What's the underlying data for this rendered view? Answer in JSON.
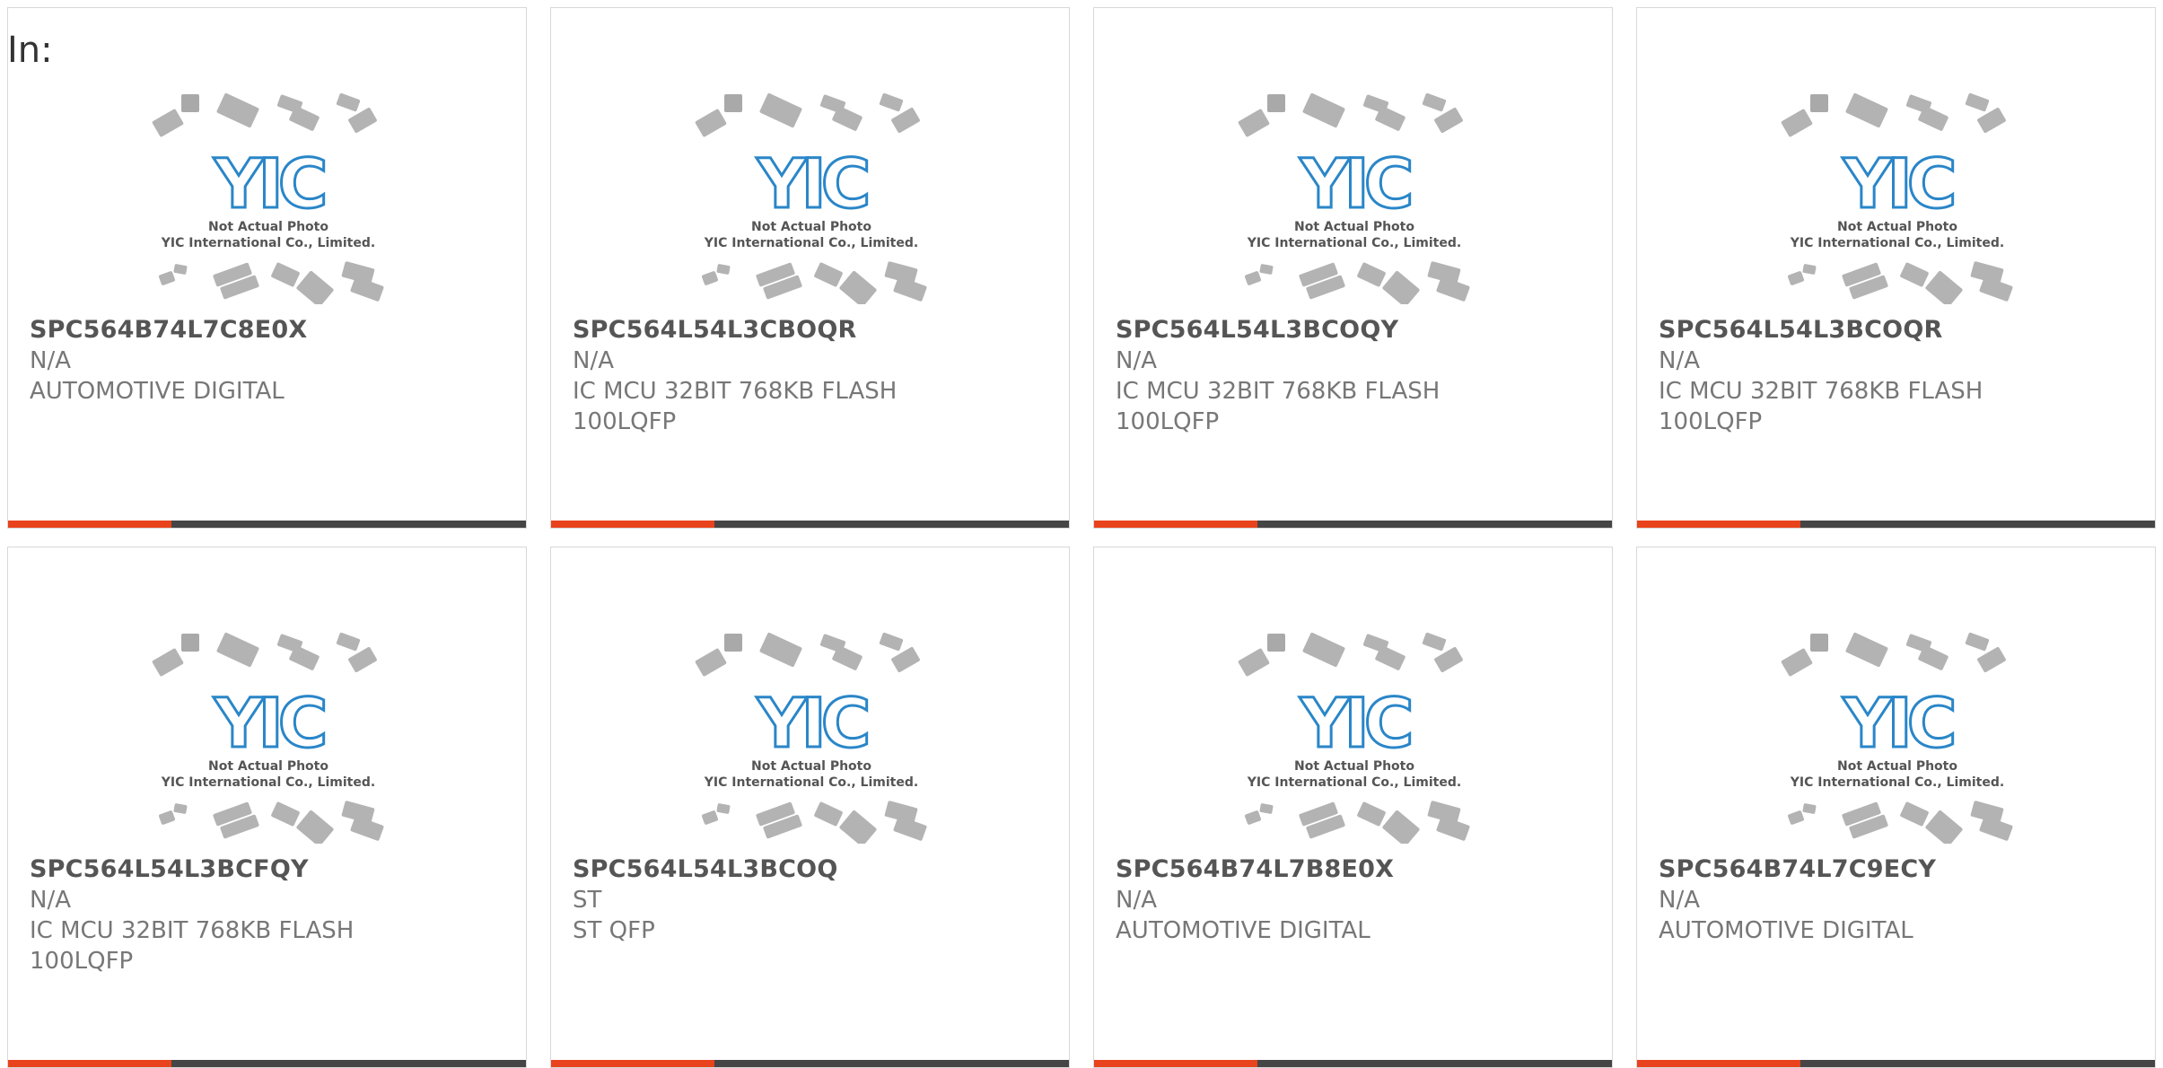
{
  "page": {
    "in_label": "In:"
  },
  "placeholder_image": {
    "icon": "not-actual-photo-placeholder",
    "logo_text": "YIC",
    "line1": "Not Actual Photo",
    "line2": "YIC International Co., Limited."
  },
  "colors": {
    "accent": "#e8431c",
    "bar_dark": "#454545",
    "logo_blue": "#2a86c8",
    "chip_gray": "#b3b3b3"
  },
  "products": [
    {
      "part": "SPC564B74L7C8E0X",
      "maker": "N/A",
      "desc1": "AUTOMOTIVE DIGITAL",
      "desc2": ""
    },
    {
      "part": "SPC564L54L3CBOQR",
      "maker": "N/A",
      "desc1": "IC MCU 32BIT 768KB FLASH",
      "desc2": "100LQFP"
    },
    {
      "part": "SPC564L54L3BCOQY",
      "maker": "N/A",
      "desc1": "IC MCU 32BIT 768KB FLASH",
      "desc2": "100LQFP"
    },
    {
      "part": "SPC564L54L3BCOQR",
      "maker": "N/A",
      "desc1": "IC MCU 32BIT 768KB FLASH",
      "desc2": "100LQFP"
    },
    {
      "part": "SPC564L54L3BCFQY",
      "maker": "N/A",
      "desc1": "IC MCU 32BIT 768KB FLASH",
      "desc2": "100LQFP"
    },
    {
      "part": "SPC564L54L3BCOQ",
      "maker": "ST",
      "desc1": "ST QFP",
      "desc2": ""
    },
    {
      "part": "SPC564B74L7B8E0X",
      "maker": "N/A",
      "desc1": "AUTOMOTIVE DIGITAL",
      "desc2": ""
    },
    {
      "part": "SPC564B74L7C9ECY",
      "maker": "N/A",
      "desc1": "AUTOMOTIVE DIGITAL",
      "desc2": ""
    }
  ]
}
